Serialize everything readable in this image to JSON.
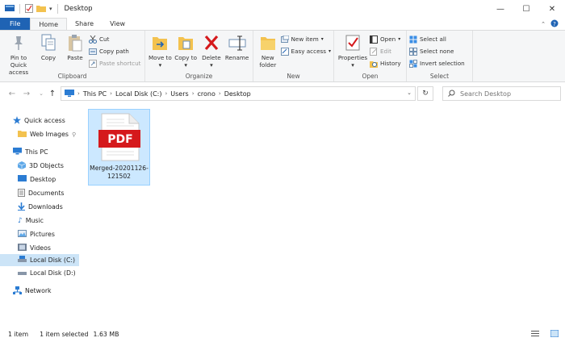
{
  "window": {
    "title": "Desktop",
    "minimize": "—",
    "maximize": "☐",
    "close": "✕"
  },
  "tabs": [
    "File",
    "Home",
    "Share",
    "View"
  ],
  "ribbon": {
    "clipboard": {
      "label": "Clipboard",
      "pin": "Pin to Quick access",
      "copy": "Copy",
      "paste": "Paste",
      "cut": "Cut",
      "copy_path": "Copy path",
      "paste_shortcut": "Paste shortcut"
    },
    "organize": {
      "label": "Organize",
      "move_to": "Move to",
      "copy_to": "Copy to",
      "delete": "Delete",
      "rename": "Rename"
    },
    "new": {
      "label": "New",
      "new_folder": "New folder",
      "new_item": "New item",
      "easy_access": "Easy access"
    },
    "open": {
      "label": "Open",
      "properties": "Properties",
      "open": "Open",
      "edit": "Edit",
      "history": "History"
    },
    "select": {
      "label": "Select",
      "select_all": "Select all",
      "select_none": "Select none",
      "invert_selection": "Invert selection"
    }
  },
  "address": {
    "crumbs": [
      "This PC",
      "Local Disk (C:)",
      "Users",
      "crono",
      "Desktop"
    ],
    "search_placeholder": "Search Desktop"
  },
  "nav": {
    "quick_access": "Quick access",
    "web_images": "Web Images",
    "this_pc": "This PC",
    "objects3d": "3D Objects",
    "desktop": "Desktop",
    "documents": "Documents",
    "downloads": "Downloads",
    "music": "Music",
    "pictures": "Pictures",
    "videos": "Videos",
    "local_c": "Local Disk (C:)",
    "local_d": "Local Disk (D:)",
    "network": "Network"
  },
  "files": [
    {
      "name": "Merged-20201126-121502",
      "badge": "PDF"
    }
  ],
  "status": {
    "count": "1 item",
    "selected": "1 item selected",
    "size": "1.63 MB"
  },
  "colors": {
    "file_tab": "#1f63b4",
    "selection": "#cce8ff",
    "pdf_red": "#d5191c"
  }
}
